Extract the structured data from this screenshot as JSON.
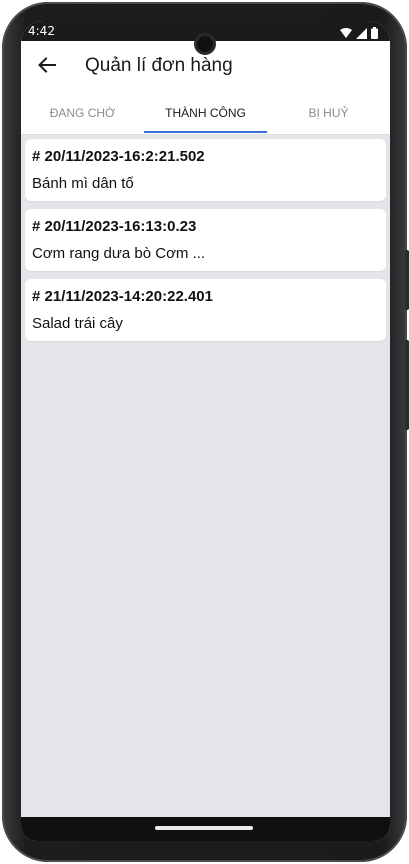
{
  "status_bar": {
    "time": "4:42",
    "icons": [
      "wifi-icon",
      "signal-icon",
      "battery-icon"
    ]
  },
  "app_bar": {
    "back_icon": "arrow-left-icon",
    "title": "Quản lí đơn hàng"
  },
  "tabs": [
    {
      "label": "ĐANG CHỜ",
      "active": false
    },
    {
      "label": "THÀNH CÔNG",
      "active": true
    },
    {
      "label": "BỊ HUỶ",
      "active": false
    }
  ],
  "orders": [
    {
      "id": "# 20/11/2023-16:2:21.502",
      "items": "Bánh mì dân tố"
    },
    {
      "id": "# 20/11/2023-16:13:0.23",
      "items": "Cơm rang dưa bò Cơm ..."
    },
    {
      "id": "# 21/11/2023-14:20:22.401",
      "items": "Salad trái cây"
    }
  ],
  "colors": {
    "accent": "#3a6fd8",
    "background": "#e4e5e9",
    "surface": "#ffffff"
  }
}
